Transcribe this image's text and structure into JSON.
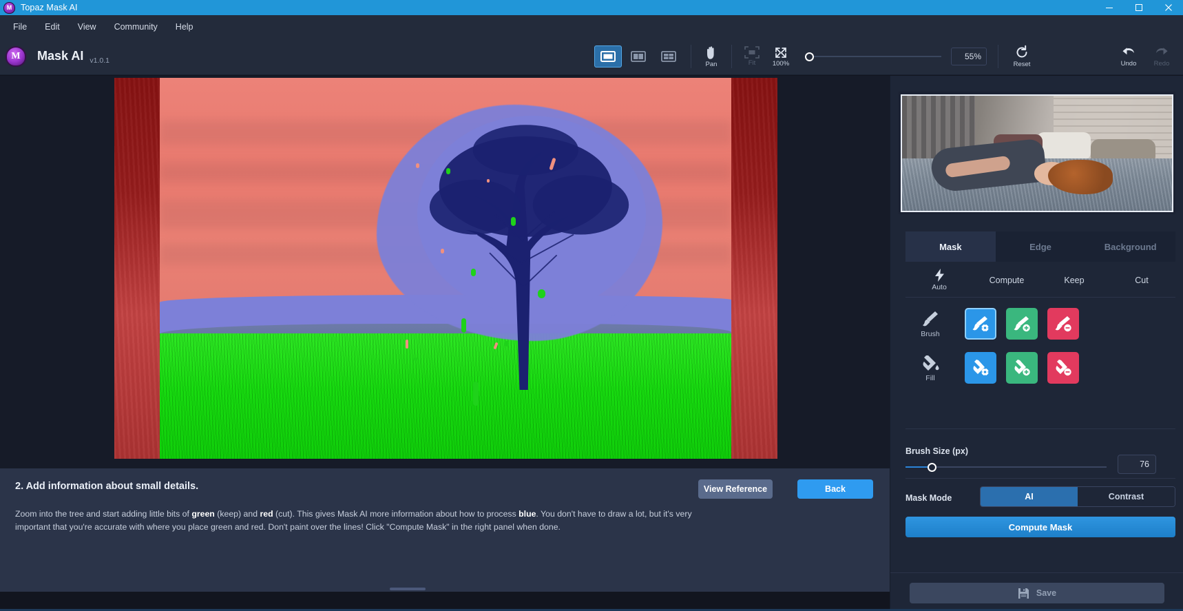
{
  "window": {
    "title": "Topaz Mask AI",
    "logo_icon": "topaz-mask-logo-icon",
    "minimize_icon": "minimize-icon",
    "maximize_icon": "maximize-icon",
    "close_icon": "close-icon"
  },
  "menubar": {
    "items": [
      {
        "label": "File"
      },
      {
        "label": "Edit"
      },
      {
        "label": "View"
      },
      {
        "label": "Community"
      },
      {
        "label": "Help"
      }
    ]
  },
  "header": {
    "brand_mark": "M",
    "brand_name": "Mask AI",
    "version": "v1.0.1",
    "view_modes": [
      {
        "name": "single-view",
        "icon": "single-pane-icon",
        "active": true
      },
      {
        "name": "split-view",
        "icon": "split-pane-icon",
        "active": false
      },
      {
        "name": "quad-view",
        "icon": "quad-pane-icon",
        "active": false
      }
    ],
    "pan": {
      "label": "Pan",
      "icon": "hand-icon"
    },
    "fit": {
      "label": "Fit",
      "icon": "fit-frame-icon"
    },
    "full": {
      "label": "100%",
      "icon": "expand-arrows-icon"
    },
    "zoom_value": "55%",
    "reset": {
      "label": "Reset",
      "icon": "reset-circular-arrow-icon"
    },
    "undo": {
      "label": "Undo",
      "icon": "undo-arrow-icon"
    },
    "redo": {
      "label": "Redo",
      "icon": "redo-arrow-icon"
    }
  },
  "instructions": {
    "title": "2. Add information about small details.",
    "body_1": "Zoom into the tree and start adding little bits of ",
    "bold_green": "green",
    "body_2": " (keep) and ",
    "bold_red": "red",
    "body_3": " (cut). This gives Mask AI more information about how to process ",
    "bold_blue": "blue",
    "body_4": ". You don't have to draw a lot, but it's very important that you're accurate with where you place green and red. Don't paint over the lines! Click \"Compute Mask\" in the right panel when done.",
    "view_reference_label": "View Reference",
    "back_label": "Back"
  },
  "panel": {
    "tabs": [
      {
        "label": "Mask",
        "active": true
      },
      {
        "label": "Edge",
        "active": false
      },
      {
        "label": "Background",
        "active": false
      }
    ],
    "modes": [
      {
        "label": "Auto",
        "icon": "lightning-bolt-icon"
      },
      {
        "label": "Compute",
        "icon": ""
      },
      {
        "label": "Keep",
        "icon": ""
      },
      {
        "label": "Cut",
        "icon": ""
      }
    ],
    "tools": [
      {
        "row_label": "Brush",
        "row_icon": "brush-icon",
        "buttons": [
          {
            "name": "brush-compute",
            "color": "#2b96e8",
            "badge": "gear",
            "selected": true
          },
          {
            "name": "brush-keep",
            "color": "#3ab77e",
            "badge": "plus",
            "selected": false
          },
          {
            "name": "brush-cut",
            "color": "#e23a5e",
            "badge": "minus",
            "selected": false
          }
        ]
      },
      {
        "row_label": "Fill",
        "row_icon": "fill-bucket-icon",
        "buttons": [
          {
            "name": "fill-compute",
            "color": "#2b96e8",
            "badge": "gear",
            "selected": false
          },
          {
            "name": "fill-keep",
            "color": "#3ab77e",
            "badge": "plus",
            "selected": false
          },
          {
            "name": "fill-cut",
            "color": "#e23a5e",
            "badge": "minus",
            "selected": false
          }
        ]
      }
    ],
    "brush_size": {
      "label": "Brush Size (px)",
      "value": "76"
    },
    "mask_mode": {
      "label": "Mask Mode",
      "options": [
        {
          "label": "AI",
          "active": true
        },
        {
          "label": "Contrast",
          "active": false
        }
      ]
    },
    "compute_mask_label": "Compute Mask",
    "save": {
      "label": "Save",
      "icon": "floppy-disk-icon",
      "disabled": true
    }
  },
  "colors": {
    "accent_blue": "#2f9bf0",
    "title_blue": "#2196d8",
    "keep_green": "#3ab77e",
    "cut_red": "#e23a5e",
    "mask_blue_overlay": "#7d80d8",
    "mask_red_overlay": "#ec8278",
    "mask_green_overlay": "#1fd21a",
    "panel_bg": "#1e2637",
    "header_bg": "#232b3b"
  }
}
